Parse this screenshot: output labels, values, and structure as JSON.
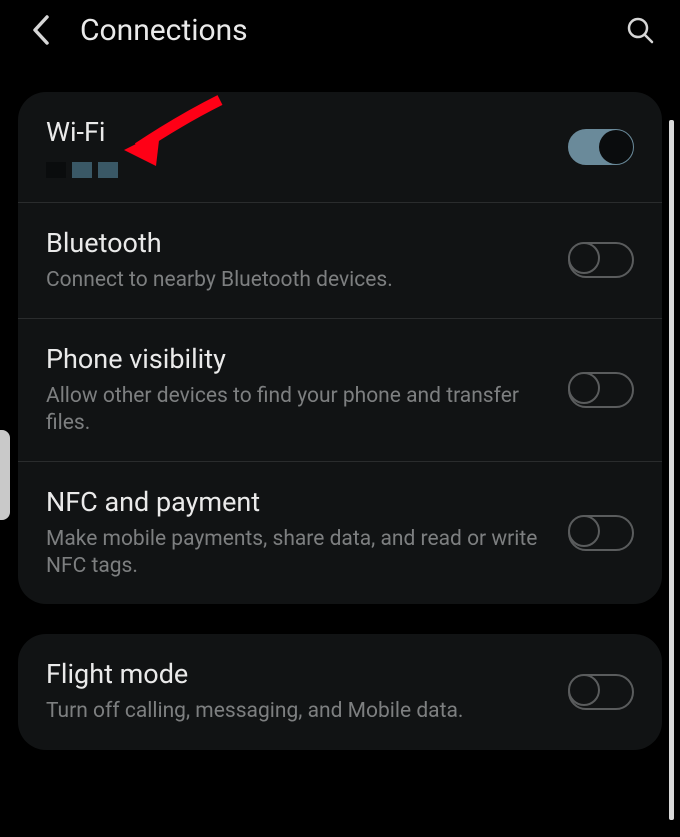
{
  "header": {
    "title": "Connections"
  },
  "settings": [
    {
      "key": "wifi",
      "title": "Wi-Fi",
      "subtitle": "",
      "enabled": true,
      "showNetworkIndicator": true
    },
    {
      "key": "bluetooth",
      "title": "Bluetooth",
      "subtitle": "Connect to nearby Bluetooth devices.",
      "enabled": false
    },
    {
      "key": "phone-visibility",
      "title": "Phone visibility",
      "subtitle": "Allow other devices to find your phone and transfer files.",
      "enabled": false
    },
    {
      "key": "nfc",
      "title": "NFC and payment",
      "subtitle": "Make mobile payments, share data, and read or write NFC tags.",
      "enabled": false
    }
  ],
  "settings2": [
    {
      "key": "flight-mode",
      "title": "Flight mode",
      "subtitle": "Turn off calling, messaging, and Mobile data.",
      "enabled": false
    }
  ],
  "annotation": {
    "arrowColor": "#ff0016"
  }
}
